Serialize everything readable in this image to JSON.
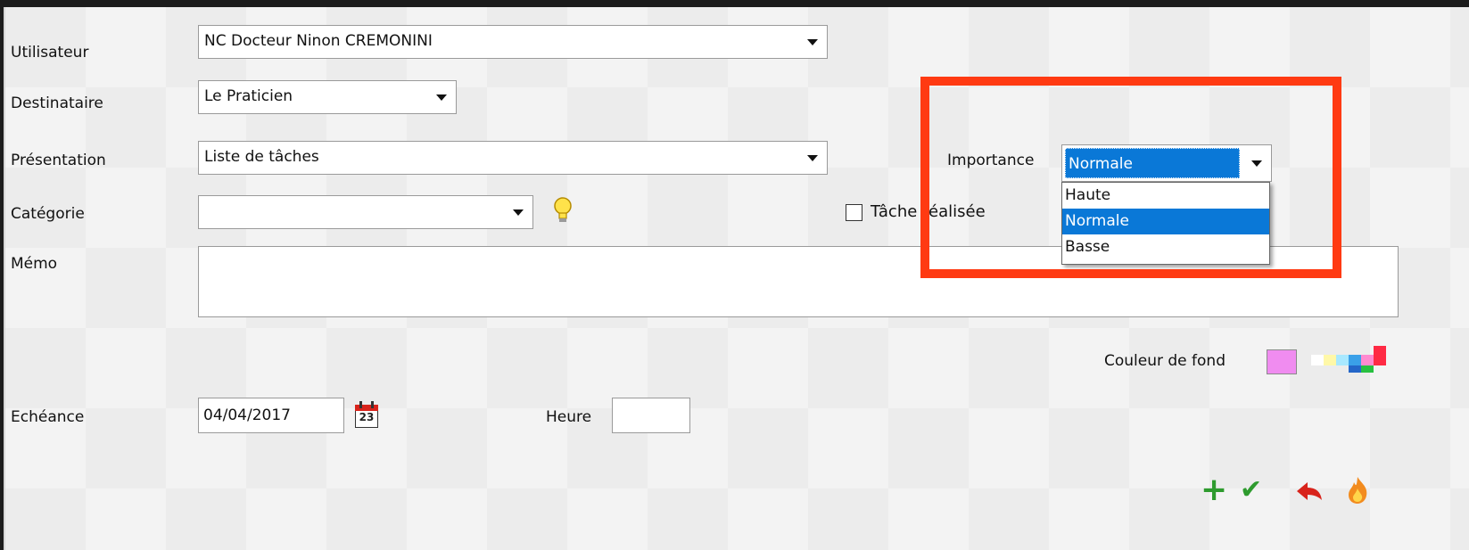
{
  "form": {
    "utilisateur": {
      "label": "Utilisateur",
      "value": "NC Docteur Ninon CREMONINI"
    },
    "destinataire": {
      "label": "Destinataire",
      "value": "Le Praticien"
    },
    "presentation": {
      "label": "Présentation",
      "value": "Liste de tâches"
    },
    "categorie": {
      "label": "Catégorie",
      "value": ""
    },
    "memo": {
      "label": "Mémo",
      "value": ""
    },
    "importance": {
      "label": "Importance",
      "value": "Normale",
      "options": [
        "Haute",
        "Normale",
        "Basse"
      ],
      "highlighted_option": "Normale"
    },
    "tache_realisee": {
      "label": "Tâche réalisée",
      "checked": false
    },
    "couleur_de_fond": {
      "label": "Couleur de fond",
      "selected_color": "#f08cf0"
    },
    "echeance": {
      "label": "Echéance",
      "value": "04/04/2017",
      "calendar_day": "23"
    },
    "heure": {
      "label": "Heure",
      "value": ""
    }
  },
  "toolbar": {
    "add_icon": "plus-icon",
    "validate_icon": "check-icon",
    "undo_icon": "undo-icon",
    "delete_icon": "flame-icon"
  },
  "colors": {
    "highlight_box": "#ff3a12",
    "selection_blue": "#0a78d7",
    "add_green": "#2e9b2e",
    "undo_red": "#d8231b"
  }
}
